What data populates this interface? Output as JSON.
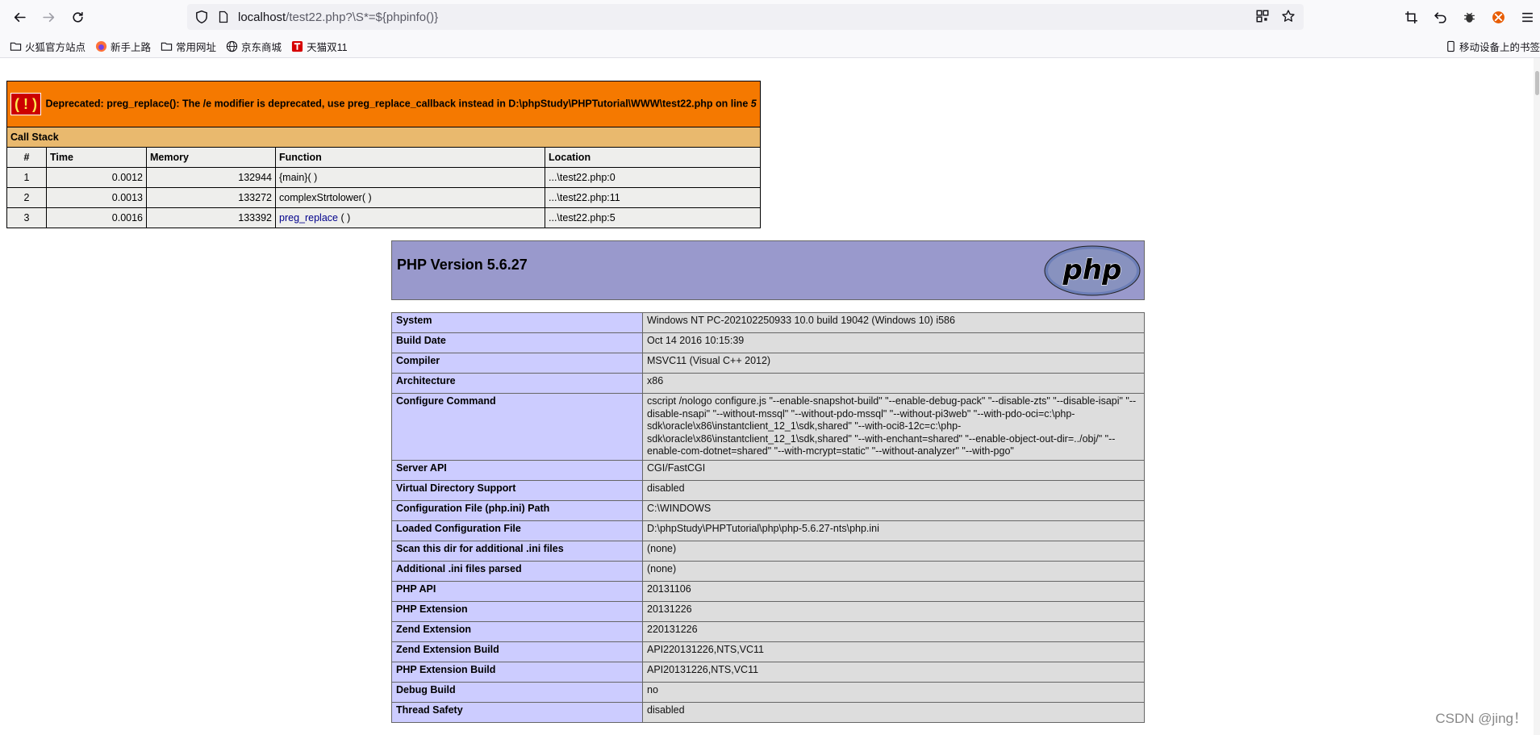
{
  "browser": {
    "url_host": "localhost",
    "url_rest": "/test22.php?\\S*=${phpinfo()}",
    "bookmarks": [
      "火狐官方站点",
      "新手上路",
      "常用网址",
      "京东商城",
      "天猫双11"
    ],
    "mobile_bookmarks": "移动设备上的书签"
  },
  "error": {
    "bang": "( ! )",
    "message": "Deprecated: preg_replace(): The /e modifier is deprecated, use preg_replace_callback instead in D:\\phpStudy\\PHPTutorial\\WWW\\test22.php on line ",
    "line": "5",
    "call_stack_label": "Call Stack",
    "columns": [
      "#",
      "Time",
      "Memory",
      "Function",
      "Location"
    ],
    "rows": [
      {
        "n": "1",
        "time": "0.0012",
        "memory": "132944",
        "fn": "{main}( )",
        "loc": "...\\test22.php:0"
      },
      {
        "n": "2",
        "time": "0.0013",
        "memory": "133272",
        "fn": "complexStrtolower( )",
        "loc": "...\\test22.php:11"
      },
      {
        "n": "3",
        "time": "0.0016",
        "memory": "133392",
        "fn": "preg_replace",
        "fn_suffix": " ( )",
        "loc": "...\\test22.php:5"
      }
    ]
  },
  "phpinfo": {
    "title": "PHP Version 5.6.27",
    "logo_text": "php",
    "rows": [
      {
        "k": "System",
        "v": "Windows NT PC-202102250933 10.0 build 19042 (Windows 10) i586"
      },
      {
        "k": "Build Date",
        "v": "Oct 14 2016 10:15:39"
      },
      {
        "k": "Compiler",
        "v": "MSVC11 (Visual C++ 2012)"
      },
      {
        "k": "Architecture",
        "v": "x86"
      },
      {
        "k": "Configure Command",
        "v": "cscript /nologo configure.js \"--enable-snapshot-build\" \"--enable-debug-pack\" \"--disable-zts\" \"--disable-isapi\" \"--disable-nsapi\" \"--without-mssql\" \"--without-pdo-mssql\" \"--without-pi3web\" \"--with-pdo-oci=c:\\php-sdk\\oracle\\x86\\instantclient_12_1\\sdk,shared\" \"--with-oci8-12c=c:\\php-sdk\\oracle\\x86\\instantclient_12_1\\sdk,shared\" \"--with-enchant=shared\" \"--enable-object-out-dir=../obj/\" \"--enable-com-dotnet=shared\" \"--with-mcrypt=static\" \"--without-analyzer\" \"--with-pgo\""
      },
      {
        "k": "Server API",
        "v": "CGI/FastCGI"
      },
      {
        "k": "Virtual Directory Support",
        "v": "disabled"
      },
      {
        "k": "Configuration File (php.ini) Path",
        "v": "C:\\WINDOWS"
      },
      {
        "k": "Loaded Configuration File",
        "v": "D:\\phpStudy\\PHPTutorial\\php\\php-5.6.27-nts\\php.ini"
      },
      {
        "k": "Scan this dir for additional .ini files",
        "v": "(none)"
      },
      {
        "k": "Additional .ini files parsed",
        "v": "(none)"
      },
      {
        "k": "PHP API",
        "v": "20131106"
      },
      {
        "k": "PHP Extension",
        "v": "20131226"
      },
      {
        "k": "Zend Extension",
        "v": "220131226"
      },
      {
        "k": "Zend Extension Build",
        "v": "API220131226,NTS,VC11"
      },
      {
        "k": "PHP Extension Build",
        "v": "API20131226,NTS,VC11"
      },
      {
        "k": "Debug Build",
        "v": "no"
      },
      {
        "k": "Thread Safety",
        "v": "disabled"
      }
    ]
  },
  "watermark": "CSDN @jing！"
}
